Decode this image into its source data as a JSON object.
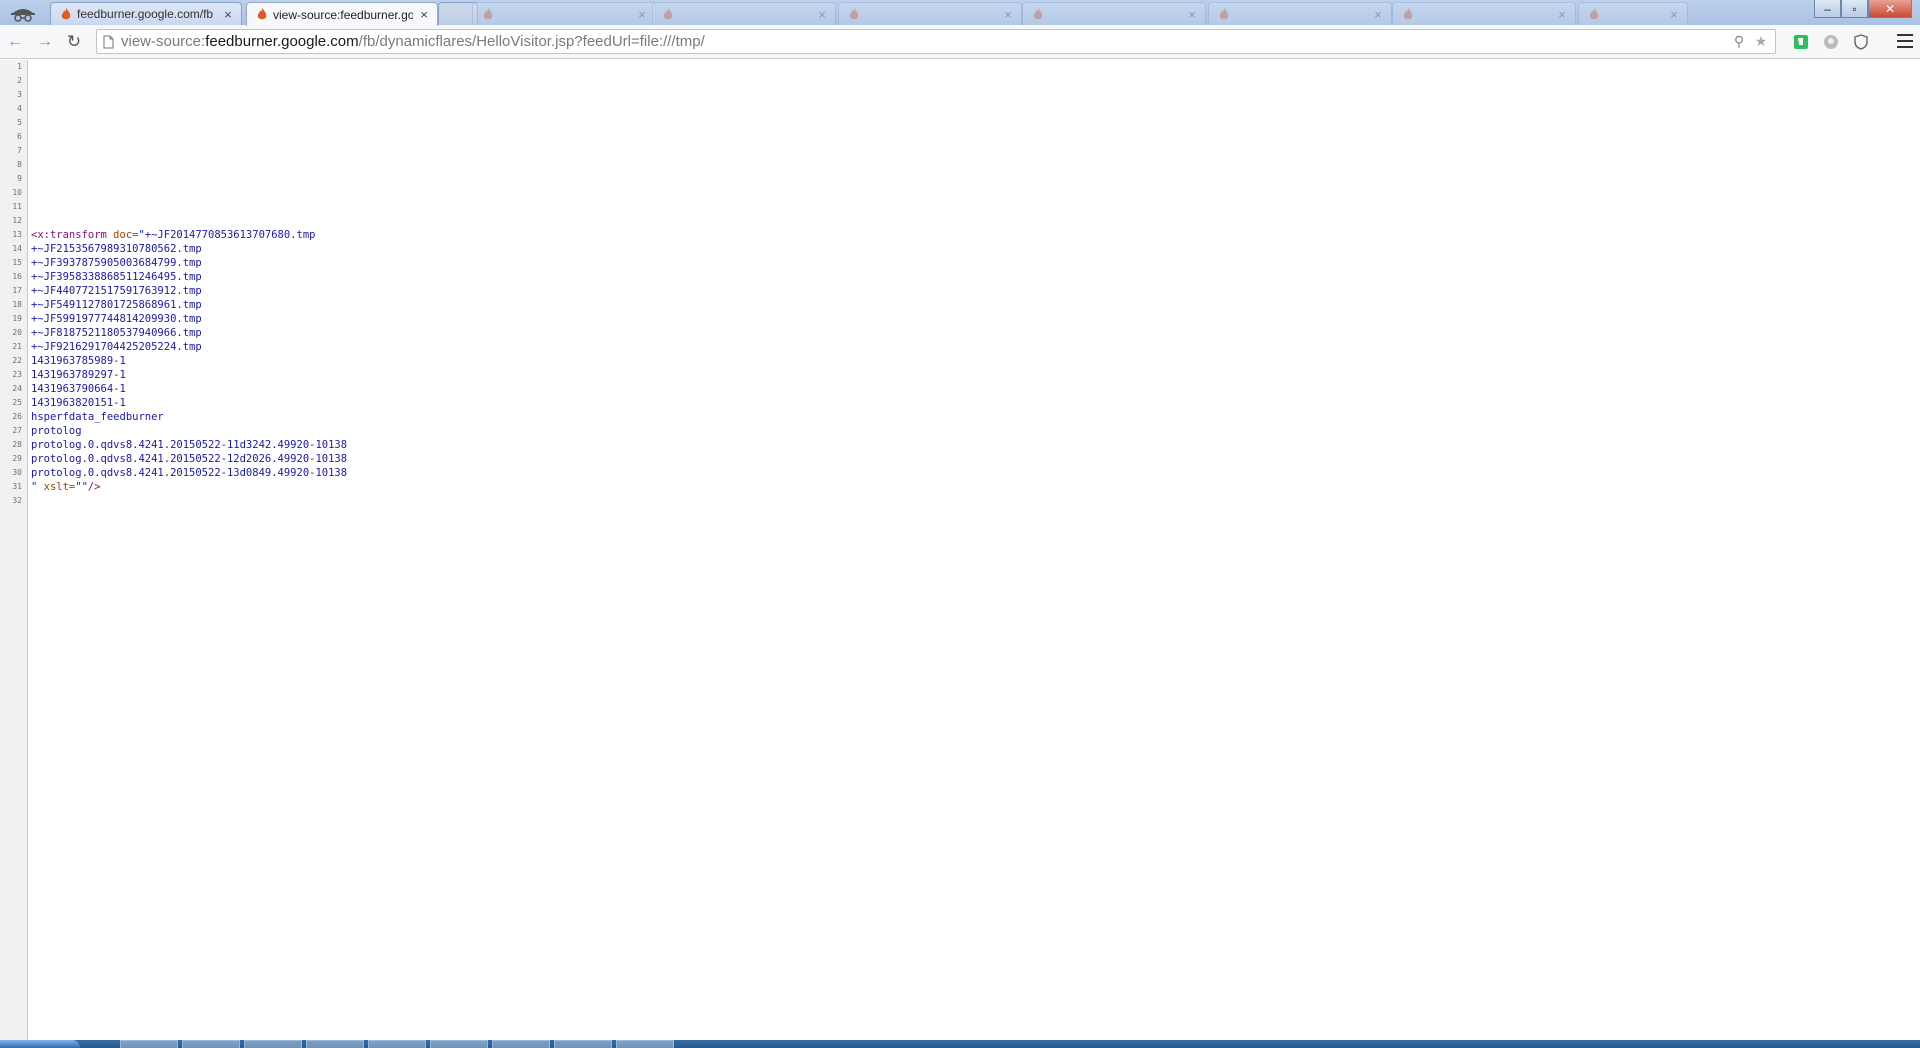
{
  "tabs": [
    {
      "title": "feedburner.google.com/fb",
      "active": false,
      "faded": false
    },
    {
      "title": "view-source:feedburner.go",
      "active": true,
      "faded": false
    },
    {
      "title": "",
      "active": false,
      "faded": false,
      "blank": true
    },
    {
      "title": "",
      "active": false,
      "faded": true
    },
    {
      "title": "",
      "active": false,
      "faded": true
    },
    {
      "title": "",
      "active": false,
      "faded": true
    },
    {
      "title": "",
      "active": false,
      "faded": true
    },
    {
      "title": "",
      "active": false,
      "faded": true
    },
    {
      "title": "",
      "active": false,
      "faded": true
    },
    {
      "title": "",
      "active": false,
      "faded": true
    }
  ],
  "close_glyph": "×",
  "window_controls": {
    "minimize": "–",
    "maximize": "▫",
    "close": "✕"
  },
  "toolbar": {
    "back_glyph": "←",
    "forward_glyph": "→",
    "reload_glyph": "↻",
    "url_prefix": "view-source:",
    "url_host": "feedburner.google.com",
    "url_path": "/fb/dynamicflares/HelloVisitor.jsp?feedUrl=file:///tmp/",
    "search_glyph": "⚲",
    "star_glyph": "★"
  },
  "icons": {
    "incognito": "incognito-icon",
    "favicon": "flame-favicon-icon",
    "page": "page-icon",
    "extensions": [
      "evernote-icon",
      "ghostery-icon",
      "shield-icon"
    ]
  },
  "colors": {
    "tag": "#881280",
    "attr": "#994500",
    "value": "#1a1aa6",
    "favicon": "#e05a28"
  },
  "source": {
    "line_count": 32,
    "lines": [
      {
        "n": 13,
        "tag": "<x:transform",
        "attr": " doc=",
        "val": "\"+~JF2014770853613707680.tmp"
      },
      {
        "n": 14,
        "val": "+~JF2153567989310780562.tmp"
      },
      {
        "n": 15,
        "val": "+~JF3937875905003684799.tmp"
      },
      {
        "n": 16,
        "val": "+~JF3958338868511246495.tmp"
      },
      {
        "n": 17,
        "val": "+~JF4407721517591763912.tmp"
      },
      {
        "n": 18,
        "val": "+~JF5491127801725868961.tmp"
      },
      {
        "n": 19,
        "val": "+~JF5991977744814209930.tmp"
      },
      {
        "n": 20,
        "val": "+~JF8187521180537940966.tmp"
      },
      {
        "n": 21,
        "val": "+~JF9216291704425205224.tmp"
      },
      {
        "n": 22,
        "val": "1431963785989-1"
      },
      {
        "n": 23,
        "val": "1431963789297-1"
      },
      {
        "n": 24,
        "val": "1431963790664-1"
      },
      {
        "n": 25,
        "val": "1431963820151-1"
      },
      {
        "n": 26,
        "val": "hsperfdata_feedburner"
      },
      {
        "n": 27,
        "val": "protolog"
      },
      {
        "n": 28,
        "val": "protolog.0.qdvs8.4241.20150522-11d3242.49920-10138"
      },
      {
        "n": 29,
        "val": "protolog.0.qdvs8.4241.20150522-12d2026.49920-10138"
      },
      {
        "n": 30,
        "val": "protolog.0.qdvs8.4241.20150522-13d0849.49920-10138"
      },
      {
        "n": 31,
        "val": "\"",
        "attr": " xslt=",
        "val2": "\"\"",
        "tag": "/>"
      }
    ]
  }
}
